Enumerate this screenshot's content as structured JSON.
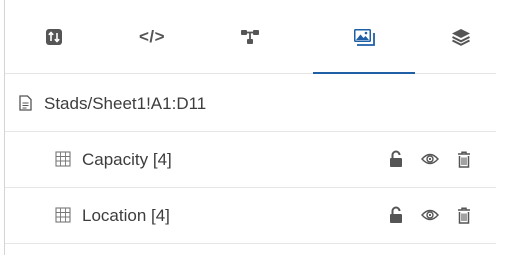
{
  "tabs": [
    {
      "icon": "swap-vertical-icon",
      "active": false
    },
    {
      "icon": "code-icon",
      "label": "</>",
      "active": false
    },
    {
      "icon": "sitemap-icon",
      "active": false
    },
    {
      "icon": "image-icon",
      "active": true
    },
    {
      "icon": "layers-icon",
      "active": false
    }
  ],
  "source": {
    "icon": "file-icon",
    "label": "Stads/Sheet1!A1:D11"
  },
  "layers": [
    {
      "icon": "table-icon",
      "label": "Capacity [4]",
      "actions": [
        "lock-icon",
        "eye-icon",
        "trash-icon"
      ]
    },
    {
      "icon": "table-icon",
      "label": "Location [4]",
      "actions": [
        "lock-icon",
        "eye-icon",
        "trash-icon"
      ]
    }
  ],
  "colors": {
    "accent": "#1f5fa6",
    "icon": "#555555",
    "text": "#3d3d3d"
  }
}
